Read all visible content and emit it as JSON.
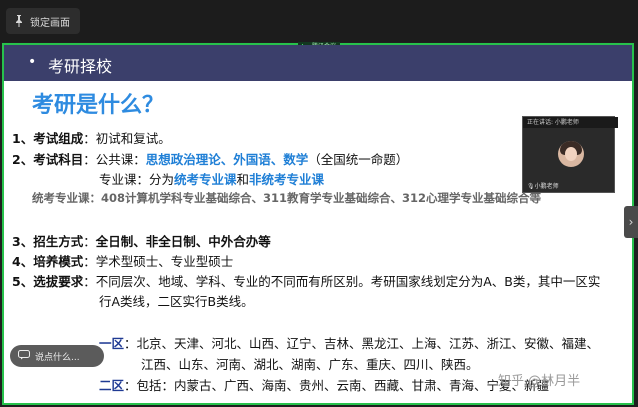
{
  "toolbar": {
    "lock_label": "锁定画面",
    "share_chip": "腾讯会议"
  },
  "slide": {
    "header_bullet": "•",
    "header_title": "考研择校",
    "question": "考研是什么？",
    "item1": {
      "num": "1、",
      "label": "考试组成",
      "sep": "：",
      "text": "初试和复试。"
    },
    "item2": {
      "num": "2、",
      "label": "考试科目",
      "sep": "：",
      "public_prefix": "公共课：",
      "public_subjects": "思想政治理论、外国语、数学",
      "public_suffix": "（全国统一命题）",
      "major_prefix": "专业课：分为",
      "major_a": "统考专业课",
      "major_and": "和",
      "major_b": "非统考专业课",
      "unified": "统考专业课：408计算机学科专业基础综合、311教育学专业基础综合、312心理学专业基础综合等"
    },
    "item3": {
      "num": "3、",
      "label": "招生方式",
      "sep": "：",
      "text": "全日制、非全日制、中外合办等"
    },
    "item4": {
      "num": "4、",
      "label": "培养模式",
      "sep": "：",
      "text": "学术型硕士、专业型硕士"
    },
    "item5": {
      "num": "5、",
      "label": "选拔要求",
      "sep": "：",
      "line1": "不同层次、地域、学科、专业的不同而有所区别。考研国家线划定分为A、B类，其中一区实",
      "line2": "行A类线，二区实行B类线。"
    },
    "zone1": {
      "label": "一区",
      "sep": "：",
      "line1": "北京、天津、河北、山西、辽宁、吉林、黑龙江、上海、江苏、浙江、安徽、福建、",
      "line2": "江西、山东、河南、湖北、湖南、广东、重庆、四川、陕西。"
    },
    "zone2": {
      "label": "二区",
      "sep": "：",
      "line1": "包括：内蒙古、广西、海南、贵州、云南、西藏、甘肃、青海、宁夏、新疆"
    }
  },
  "video": {
    "top_text": "正在讲话: 小鹏老师",
    "bottom_text": "小鹏老师"
  },
  "comment": {
    "placeholder": "说点什么..."
  },
  "watermark": "知乎 @林月半",
  "colors": {
    "accent_green": "#27c24c",
    "header_bg": "#3b3f6b",
    "title_blue": "#2e8be0"
  }
}
